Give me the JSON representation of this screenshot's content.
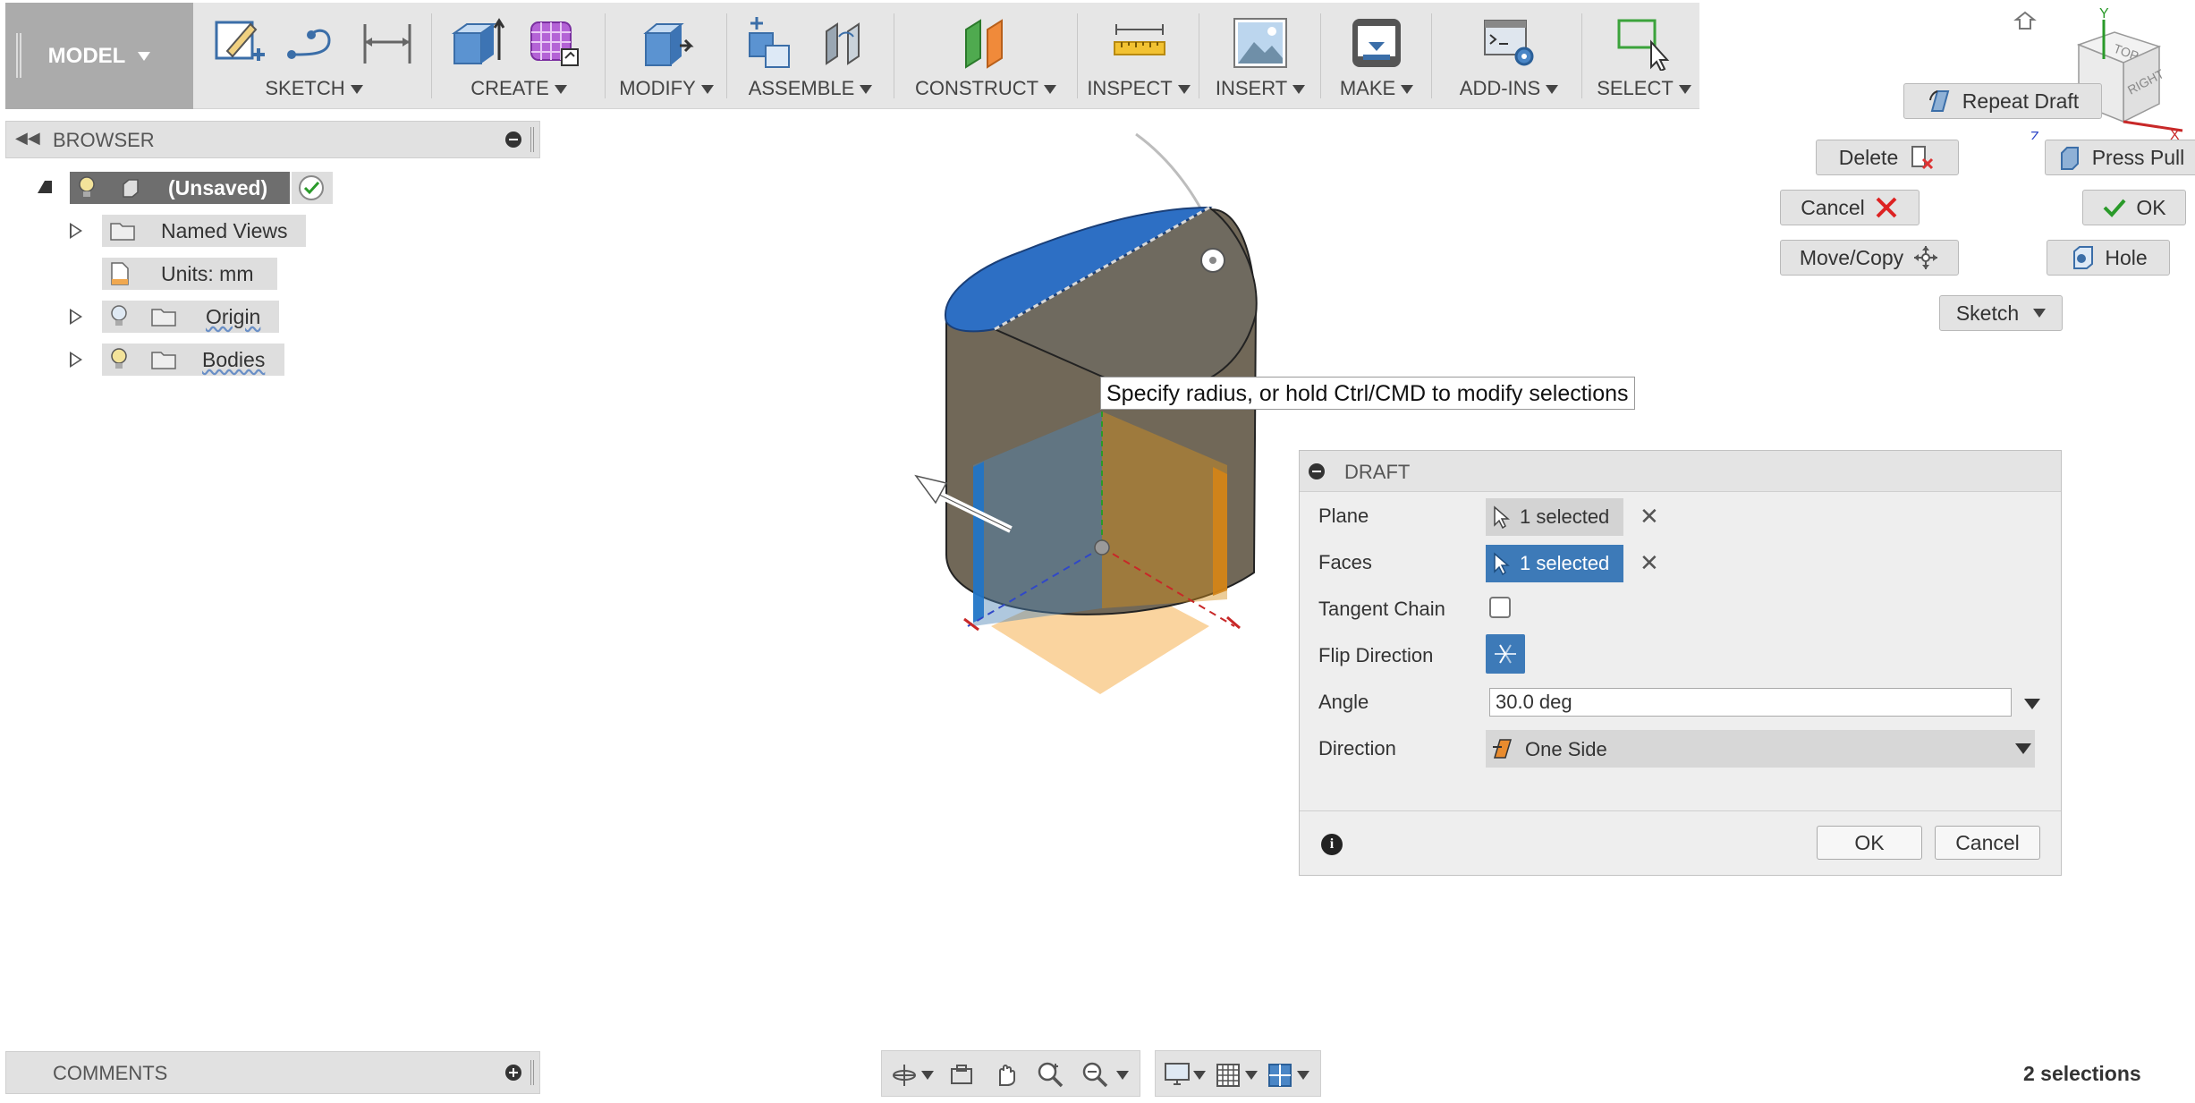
{
  "toolbar": {
    "model": "MODEL",
    "groups": [
      {
        "label": "SKETCH"
      },
      {
        "label": "CREATE"
      },
      {
        "label": "MODIFY"
      },
      {
        "label": "ASSEMBLE"
      },
      {
        "label": "CONSTRUCT"
      },
      {
        "label": "INSPECT"
      },
      {
        "label": "INSERT"
      },
      {
        "label": "MAKE"
      },
      {
        "label": "ADD-INS"
      },
      {
        "label": "SELECT"
      }
    ]
  },
  "browser": {
    "title": "BROWSER",
    "root": "(Unsaved)",
    "items": [
      {
        "label": "Named Views"
      },
      {
        "label": "Units: mm"
      },
      {
        "label": "Origin"
      },
      {
        "label": "Bodies"
      }
    ]
  },
  "comments": {
    "title": "COMMENTS"
  },
  "viewport": {
    "tooltip": "Specify radius, or hold Ctrl/CMD to modify selections",
    "viewcube": {
      "top": "TOP",
      "right": "RIGHT",
      "axis_y": "Y",
      "axis_x": "X",
      "axis_z": "Z"
    },
    "marking_menu": {
      "repeat": "Repeat Draft",
      "delete": "Delete",
      "press_pull": "Press Pull",
      "cancel": "Cancel",
      "ok": "OK",
      "move_copy": "Move/Copy",
      "hole": "Hole",
      "sketch": "Sketch"
    }
  },
  "draft": {
    "title": "DRAFT",
    "plane_label": "Plane",
    "plane_value": "1 selected",
    "faces_label": "Faces",
    "faces_value": "1 selected",
    "tangent_label": "Tangent Chain",
    "tangent_checked": false,
    "flip_label": "Flip Direction",
    "angle_label": "Angle",
    "angle_value": "30.0 deg",
    "direction_label": "Direction",
    "direction_value": "One Side",
    "ok": "OK",
    "cancel": "Cancel"
  },
  "status": {
    "selections": "2 selections"
  },
  "colors": {
    "accent": "#3d7ab8",
    "selected_face": "#2d6fc4",
    "toolbar_bg": "#e6e6e6",
    "model_bg": "#ababab"
  }
}
